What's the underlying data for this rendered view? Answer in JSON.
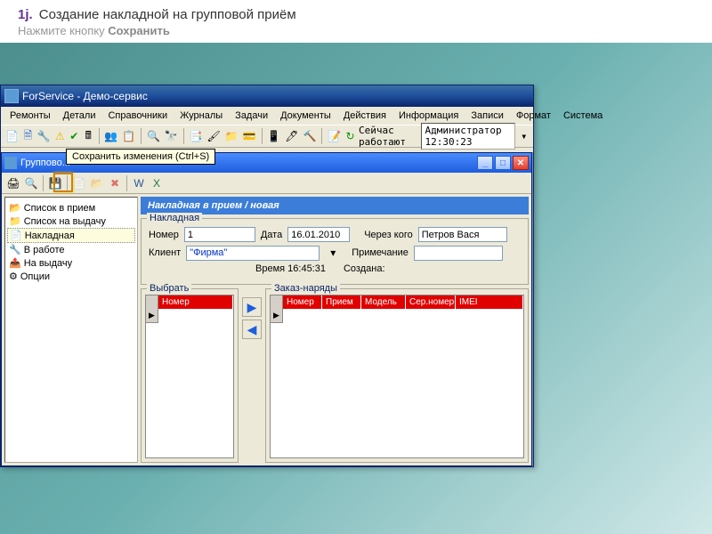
{
  "header": {
    "step": "1j.",
    "title": "Создание накладной на групповой приём",
    "subtitle_prefix": "Нажмите кнопку ",
    "subtitle_bold": "Сохранить"
  },
  "app": {
    "title": "ForService - Демо-сервис",
    "menu": [
      "Ремонты",
      "Детали",
      "Справочники",
      "Журналы",
      "Задачи",
      "Документы",
      "Действия",
      "Информация",
      "Записи",
      "Формат",
      "Система"
    ],
    "status_label": "Сейчас работают",
    "status_user": "Администратор 12:30:23"
  },
  "child": {
    "title": "Группово...",
    "tooltip": "Сохранить изменения (Ctrl+S)"
  },
  "tree": [
    {
      "icon": "folder-open",
      "label": "Список в прием"
    },
    {
      "icon": "folder-closed",
      "label": "Список на выдачу"
    },
    {
      "icon": "page",
      "label": "Накладная",
      "sel": true
    },
    {
      "icon": "tool",
      "label": "В работе"
    },
    {
      "icon": "out",
      "label": "На выдачу"
    },
    {
      "icon": "gear",
      "label": "Опции"
    }
  ],
  "panel_title": "Накладная в прием / новая",
  "form": {
    "fieldset": "Накладная",
    "labels": {
      "nomer": "Номер",
      "data": "Дата",
      "cherez": "Через кого",
      "klient": "Клиент",
      "prim": "Примечание",
      "vremya": "Время",
      "sozdana": "Создана:"
    },
    "values": {
      "nomer": "1",
      "data": "16.01.2010",
      "cherez": "Петров Вася",
      "klient": "\"Фирма\"",
      "prim": "",
      "vremya": "16:45:31",
      "sozdana": ""
    }
  },
  "grids": {
    "left_fs": "Выбрать",
    "right_fs": "Заказ-наряды",
    "left_cols": [
      "Номер"
    ],
    "right_cols": [
      "Номер",
      "Прием",
      "Модель",
      "Сер.номер",
      "IMEI"
    ]
  }
}
